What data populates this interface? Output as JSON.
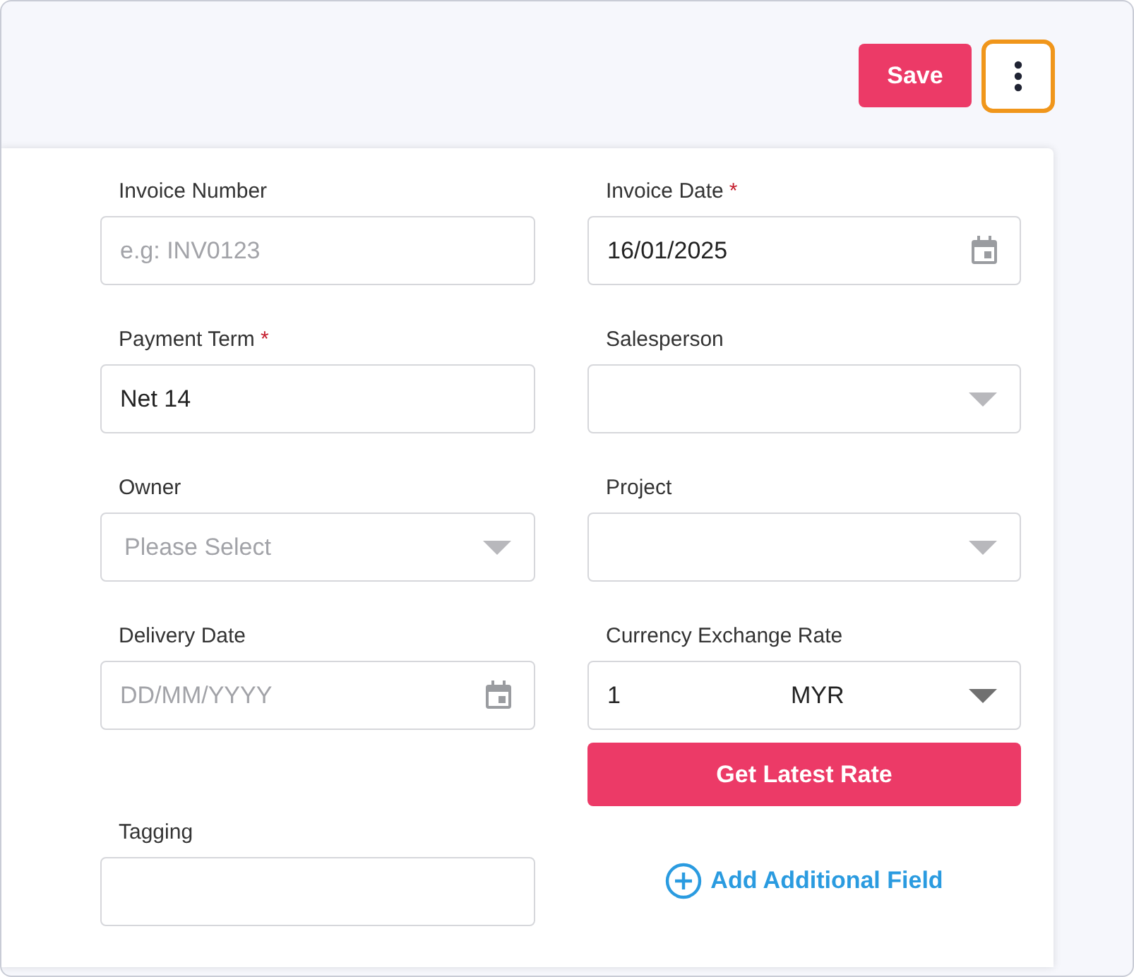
{
  "header": {
    "save_button": "Save"
  },
  "fields": [
    {
      "kind": "text",
      "label": "Invoice Number",
      "placeholder": "e.g: INV0123"
    },
    {
      "kind": "date",
      "label": "Invoice Date",
      "required_mark": "*",
      "value": "16/01/2025"
    },
    {
      "kind": "text",
      "label": "Payment Term",
      "required_mark": "*",
      "value": "Net 14"
    },
    {
      "kind": "select",
      "label": "Salesperson"
    },
    {
      "kind": "select",
      "label": "Owner",
      "placeholder": "Please Select"
    },
    {
      "kind": "select",
      "label": "Project"
    },
    {
      "kind": "date",
      "label": "Delivery Date",
      "placeholder": "DD/MM/YYYY"
    },
    {
      "kind": "rate",
      "label": "Currency Exchange Rate",
      "value": "1",
      "currency": "MYR",
      "action_button": "Get Latest Rate"
    },
    {
      "kind": "text",
      "label": "Tagging"
    }
  ],
  "add_field_link": "Add Additional Field"
}
